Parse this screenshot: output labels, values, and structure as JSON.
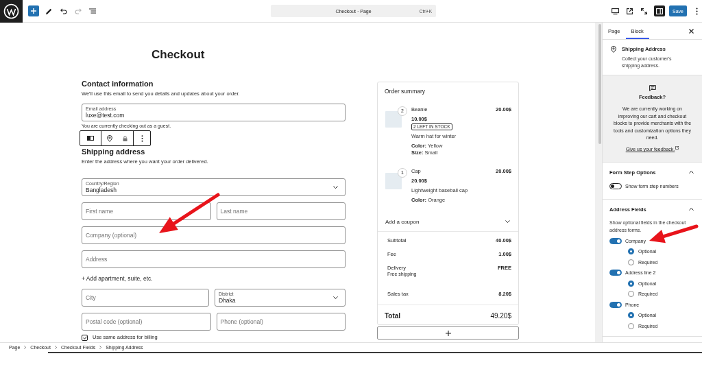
{
  "top_bar": {
    "undo": {
      "disabled": false
    },
    "redo": {
      "disabled": true
    },
    "command_bar": {
      "title": "Checkout · Page",
      "shortcut": "Ctrl+K"
    },
    "settings_toggle": {
      "pressed": true
    },
    "save_button": "Save"
  },
  "page_title": "Checkout",
  "contact": {
    "heading": "Contact information",
    "description": "We'll use this email to send you details and updates about your order.",
    "email": {
      "kind": "email",
      "label": "Email address",
      "value": "luxe@test.com"
    },
    "note": "You are currently checking out as a guest."
  },
  "shipping": {
    "heading": "Shipping address",
    "description": "Enter the address where you want your order delivered.",
    "rows": [
      {
        "kind": "fields",
        "fields": [
          {
            "kind": "select",
            "label": "Country/Region",
            "value": "Bangladesh"
          }
        ]
      },
      {
        "kind": "fields",
        "fields": [
          {
            "kind": "text",
            "placeholder": "First name"
          },
          {
            "kind": "text",
            "placeholder": "Last name"
          }
        ]
      },
      {
        "kind": "fields",
        "fields": [
          {
            "kind": "text",
            "placeholder": "Company (optional)"
          }
        ]
      },
      {
        "kind": "fields",
        "fields": [
          {
            "kind": "text",
            "placeholder": "Address"
          }
        ]
      },
      {
        "kind": "link",
        "label": "+ Add apartment, suite, etc."
      },
      {
        "kind": "fields",
        "fields": [
          {
            "kind": "text",
            "placeholder": "City"
          },
          {
            "kind": "select",
            "label": "District",
            "value": "Dhaka"
          }
        ]
      },
      {
        "kind": "fields",
        "fields": [
          {
            "kind": "text",
            "placeholder": "Postal code (optional)"
          },
          {
            "kind": "text",
            "placeholder": "Phone (optional)"
          }
        ]
      }
    ],
    "billing": {
      "label": "Use same address for billing",
      "checked": true
    }
  },
  "order_summary": {
    "title": "Order summary",
    "items": [
      {
        "quantity": "2",
        "name": "Beanie",
        "line_total": "20.00$",
        "price": "10.00$",
        "stock": "2 LEFT IN STOCK",
        "description": "Warm hat for winter",
        "attributes": [
          {
            "name": "Color:",
            "value": "Yellow"
          },
          {
            "name": "Size:",
            "value": "Small"
          }
        ]
      },
      {
        "quantity": "1",
        "name": "Cap",
        "line_total": "20.00$",
        "price": "20.00$",
        "description": "Lightweight baseball cap",
        "attributes": [
          {
            "name": "Color:",
            "value": "Orange"
          }
        ]
      }
    ],
    "coupon": {
      "label": "Add a coupon",
      "expanded": false
    },
    "totals": [
      {
        "label": "Subtotal",
        "value": "40.00$"
      },
      {
        "label": "Fee",
        "value": "1.00$"
      },
      {
        "label": "Delivery",
        "note": "Free shipping",
        "value": "FREE"
      },
      {
        "label": "Sales tax",
        "value": "8.20$"
      }
    ],
    "total": {
      "label": "Total",
      "value": "49.20$"
    }
  },
  "sidebar": {
    "tabs": [
      {
        "label": "Page",
        "selected": false
      },
      {
        "label": "Block",
        "selected": true
      }
    ],
    "block": {
      "title": "Shipping Address",
      "description": "Collect your customer's shipping address."
    },
    "feedback": {
      "title": "Feedback?",
      "text": "We are currently working on improving our cart and checkout blocks to provide merchants with the tools and customization options they need.",
      "link": "Give us your feedback."
    },
    "panels": [
      {
        "title": "Form Step Options",
        "expanded": true,
        "options": [
          {
            "label": "Show form step numbers",
            "on": false
          }
        ]
      },
      {
        "title": "Address Fields",
        "expanded": true,
        "description": "Show optional fields in the checkout address forms.",
        "options": [
          {
            "label": "Company",
            "on": true,
            "choices": [
              {
                "label": "Optional",
                "selected": true
              },
              {
                "label": "Required",
                "selected": false
              }
            ]
          },
          {
            "label": "Address line 2",
            "on": true,
            "choices": [
              {
                "label": "Optional",
                "selected": true
              },
              {
                "label": "Required",
                "selected": false
              }
            ]
          },
          {
            "label": "Phone",
            "on": true,
            "choices": [
              {
                "label": "Optional",
                "selected": true
              },
              {
                "label": "Required",
                "selected": false
              }
            ]
          }
        ]
      }
    ]
  },
  "breadcrumbs": [
    "Page",
    "Checkout",
    "Checkout Fields",
    "Shipping Address"
  ]
}
